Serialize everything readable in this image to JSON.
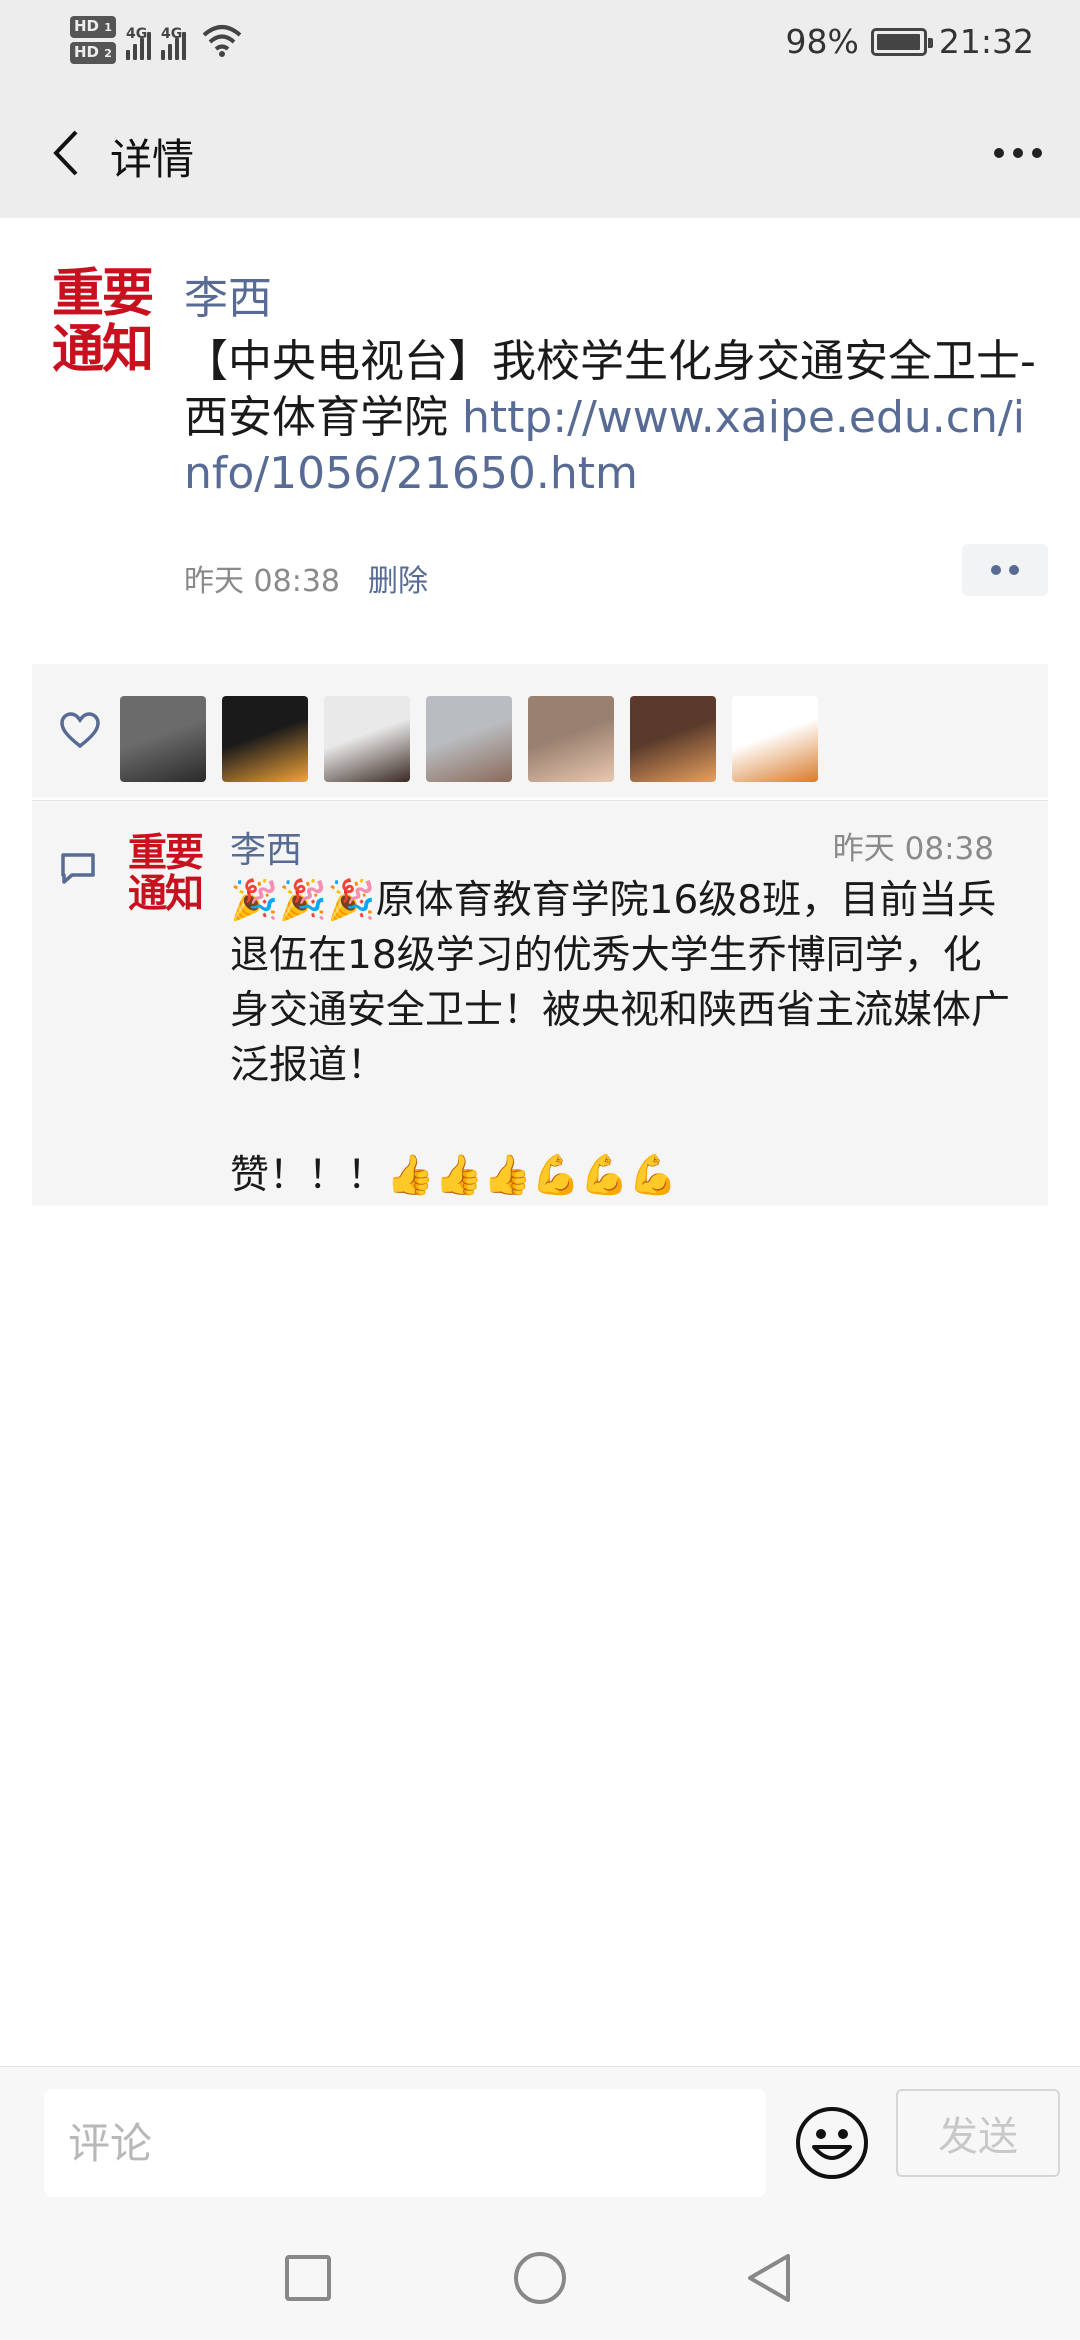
{
  "status_bar": {
    "hd1": "HD",
    "hd1_sub": "1",
    "hd2": "HD",
    "hd2_sub": "2",
    "net1": "4G",
    "net2": "4G",
    "battery_pct_text": "98%",
    "battery_level": 0.98,
    "time": "21:32"
  },
  "nav": {
    "title": "详情"
  },
  "post": {
    "avatar_lines": [
      "重要",
      "通知"
    ],
    "author": "李西",
    "text": "【中央电视台】我校学生化身交通安全卫士-西安体育学院 ",
    "link": "http://www.xaipe.edu.cn/info/1056/21650.htm",
    "time": "昨天 08:38",
    "delete_label": "删除"
  },
  "likes": {
    "avatars": [
      {
        "name": "like-avatar-1",
        "colors": [
          "#6b6b6b",
          "#2a2a2a"
        ]
      },
      {
        "name": "like-avatar-2",
        "colors": [
          "#1a1a1a",
          "#f2a53a"
        ]
      },
      {
        "name": "like-avatar-3",
        "colors": [
          "#e9e9e9",
          "#3a2a22"
        ]
      },
      {
        "name": "like-avatar-4",
        "colors": [
          "#b9bcc0",
          "#8a6a5a"
        ]
      },
      {
        "name": "like-avatar-5",
        "colors": [
          "#9a8070",
          "#e8c8b0"
        ]
      },
      {
        "name": "like-avatar-6",
        "colors": [
          "#5a3a2a",
          "#e8a060"
        ]
      },
      {
        "name": "like-avatar-7",
        "colors": [
          "#ffffff",
          "#d87a2a"
        ]
      }
    ]
  },
  "comment": {
    "avatar_lines": [
      "重要",
      "通知"
    ],
    "author": "李西",
    "time": "昨天 08:38",
    "text": "🎉🎉🎉原体育教育学院16级8班，目前当兵退伍在18级学习的优秀大学生乔博同学，化身交通安全卫士！被央视和陕西省主流媒体广泛报道！\n\n赞！！！👍👍👍💪💪💪"
  },
  "input": {
    "placeholder": "评论",
    "send_label": "发送"
  },
  "colors": {
    "link": "#576b95",
    "badge_red": "#c8101f",
    "bar_bg": "#ededed"
  }
}
